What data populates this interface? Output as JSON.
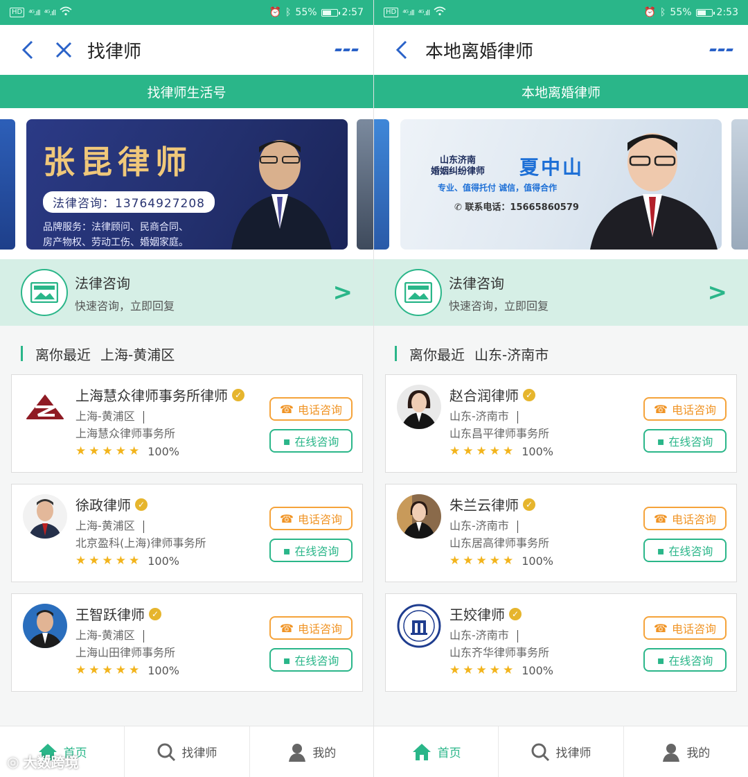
{
  "statusbar_left": {
    "hd": "HD",
    "net1": "⁴ᴳ.ıll",
    "net2": "⁴ᴳ.ıll",
    "battery_pct": "55%",
    "time": "2:57"
  },
  "statusbar_right": {
    "hd": "HD",
    "net1": "⁴ᴳ.ıll",
    "net2": "⁴ᴳ.ıll",
    "battery_pct": "55%",
    "time": "2:53"
  },
  "left": {
    "title": "找律师",
    "greenbar": "找律师生活号",
    "banner": {
      "name": "张昆律师",
      "phone": "法律咨询：13764927208",
      "services_line1": "品牌服务：法律顾问、民商合同、",
      "services_line2": "房产物权、劳动工伤、婚姻家庭。"
    },
    "consult": {
      "title": "法律咨询",
      "subtitle": "快速咨询，立即回复"
    },
    "nearest": {
      "label": "离你最近",
      "location": "上海-黄浦区"
    },
    "lawyers": [
      {
        "name": "上海慧众律师事务所律师",
        "location": "上海-黄浦区",
        "firm": "上海慧众律师事务所",
        "rating": "100%"
      },
      {
        "name": "徐政律师",
        "location": "上海-黄浦区",
        "firm": "北京盈科(上海)律师事务所",
        "rating": "100%"
      },
      {
        "name": "王智跃律师",
        "location": "上海-黄浦区",
        "firm": "上海山田律师事务所",
        "rating": "100%"
      }
    ],
    "tabs": [
      "首页",
      "找律师",
      "我的"
    ]
  },
  "right": {
    "title": "本地离婚律师",
    "greenbar": "本地离婚律师",
    "banner": {
      "top_line1": "山东济南",
      "top_line2": "婚姻纠纷律师",
      "name": "夏中山",
      "slogan": "专业、值得托付  诚信，值得合作",
      "tel": "联系电话：15665860579"
    },
    "consult": {
      "title": "法律咨询",
      "subtitle": "快速咨询，立即回复"
    },
    "nearest": {
      "label": "离你最近",
      "location": "山东-济南市"
    },
    "lawyers": [
      {
        "name": "赵合润律师",
        "location": "山东-济南市",
        "firm": "山东昌平律师事务所",
        "rating": "100%"
      },
      {
        "name": "朱兰云律师",
        "location": "山东-济南市",
        "firm": "山东居高律师事务所",
        "rating": "100%"
      },
      {
        "name": "王姣律师",
        "location": "山东-济南市",
        "firm": "山东齐华律师事务所",
        "rating": "100%"
      }
    ],
    "tabs": [
      "首页",
      "找律师",
      "我的"
    ]
  },
  "buttons": {
    "phone": "电话咨询",
    "online": "在线咨询"
  },
  "watermark": "大数跨境",
  "colors": {
    "accent": "#2ab689",
    "phone_button": "#f5a33a",
    "verify_badge": "#e6b52d",
    "star": "#f2b41c"
  }
}
